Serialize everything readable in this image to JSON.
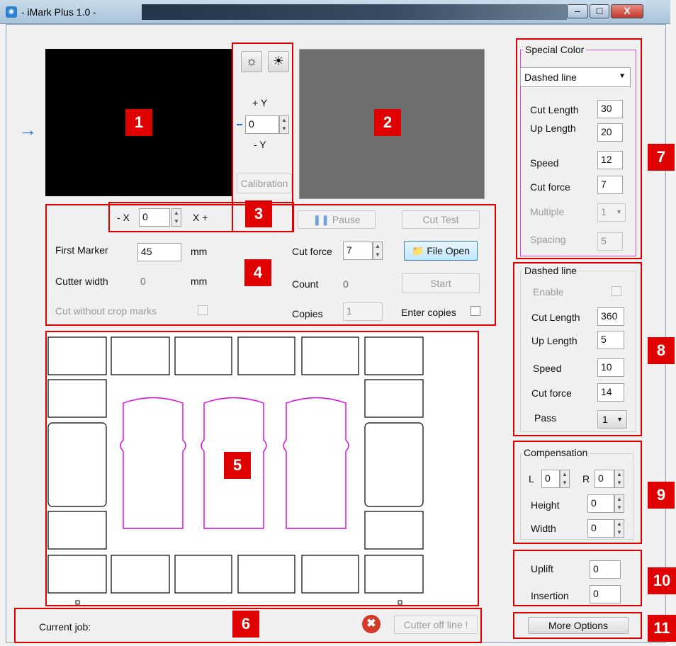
{
  "window": {
    "title": "- iMark Plus 1.0 -",
    "min_label": "–",
    "max_label": "□",
    "close_label": "X"
  },
  "camera": {
    "panel1_tag": "1",
    "panel2_tag": "2",
    "panel3_tag": "3",
    "brightness_down_icon": "brightness-low-icon",
    "brightness_up_icon": "brightness-high-icon",
    "plus_y": "+ Y",
    "minus_y": "- Y",
    "y_value": "0",
    "calibration": "Calibration",
    "minus_x": "- X",
    "x_value": "0",
    "plus_x": "X +",
    "arrow": "→"
  },
  "controls": {
    "tag": "4",
    "pause": "Pause",
    "cut_test": "Cut Test",
    "file_open": "File Open",
    "start": "Start",
    "first_marker_label": "First Marker",
    "first_marker_value": "45",
    "first_marker_unit": "mm",
    "cutter_width_label": "Cutter width",
    "cutter_width_value": "0",
    "cutter_width_unit": "mm",
    "cut_without_crop_marks": "Cut without crop marks",
    "cutforce_label": "Cut force",
    "cutforce_value": "7",
    "count_label": "Count",
    "count_value": "0",
    "copies_label": "Copies",
    "copies_value": "1",
    "enter_copies": "Enter copies"
  },
  "preview": {
    "tag": "5"
  },
  "status": {
    "tag": "6",
    "current_job_label": "Current job:",
    "cutter_status": "Cutter off line !"
  },
  "special_color": {
    "tag": "7",
    "title": "Special Color",
    "mode": "Dashed line",
    "cut_length_label": "Cut Length",
    "cut_length": "30",
    "up_length_label": "Up Length",
    "up_length": "20",
    "speed_label": "Speed",
    "speed": "12",
    "cutforce_label": "Cut force",
    "cutforce": "7",
    "multiple_label": "Multiple",
    "multiple": "1",
    "spacing_label": "Spacing",
    "spacing": "5"
  },
  "dashed_line": {
    "tag": "8",
    "title": "Dashed line",
    "enable_label": "Enable",
    "cut_length_label": "Cut Length",
    "cut_length": "360",
    "up_length_label": "Up Length",
    "up_length": "5",
    "speed_label": "Speed",
    "speed": "10",
    "cutforce_label": "Cut force",
    "cutforce": "14",
    "pass_label": "Pass",
    "pass": "1"
  },
  "compensation": {
    "tag": "9",
    "title": "Compensation",
    "l_label": "L",
    "l_value": "0",
    "r_label": "R",
    "r_value": "0",
    "height_label": "Height",
    "height_value": "0",
    "width_label": "Width",
    "width_value": "0"
  },
  "uplift": {
    "tag": "10",
    "uplift_label": "Uplift",
    "uplift_value": "0",
    "insertion_label": "Insertion",
    "insertion_value": "0"
  },
  "more": {
    "tag": "11",
    "more_options": "More Options"
  },
  "colors": {
    "outline": "#e10000",
    "cut_path": "#e000e0"
  }
}
